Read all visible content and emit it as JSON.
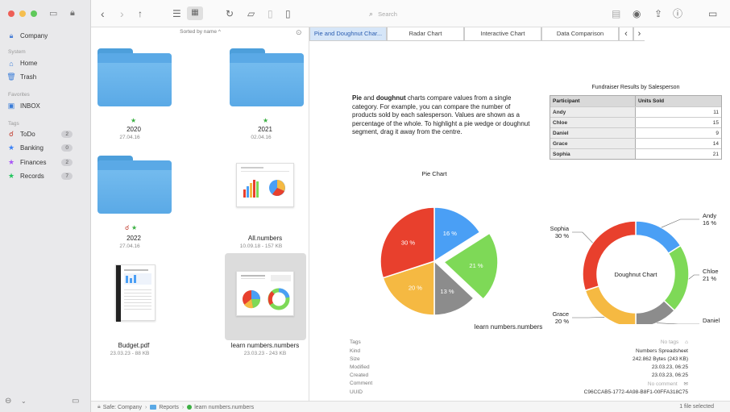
{
  "sidebar": {
    "account": "Company",
    "section_system": "System",
    "section_favorites": "Favorites",
    "section_tags": "Tags",
    "items": [
      {
        "label": "Home",
        "icon": "home-icon"
      },
      {
        "label": "Trash",
        "icon": "trash-icon"
      },
      {
        "label": "INBOX",
        "icon": "inbox-icon"
      }
    ],
    "tags": [
      {
        "label": "ToDo",
        "count": "2",
        "color": "#c0392b"
      },
      {
        "label": "Banking",
        "count": "0",
        "color": "#3b82f6"
      },
      {
        "label": "Finances",
        "count": "2",
        "color": "#a855f7"
      },
      {
        "label": "Records",
        "count": "7",
        "color": "#22c55e"
      }
    ]
  },
  "toolbar": {
    "search_placeholder": "Search"
  },
  "filelist": {
    "sort_label": "Sorted by name ^",
    "files": [
      {
        "name": "2020",
        "date": "27.04.16"
      },
      {
        "name": "2021",
        "date": "02.04.16"
      },
      {
        "name": "2022",
        "date": "27.04.16"
      },
      {
        "name": "All.numbers",
        "date": "10.09.18 - 157 KB"
      },
      {
        "name": "Budget.pdf",
        "date": "23.03.23 - 88 KB"
      },
      {
        "name": "learn numbers.numbers",
        "date": "23.03.23 - 243 KB"
      }
    ]
  },
  "preview": {
    "tabs": [
      "Pie and Doughnut Char...",
      "Radar Chart",
      "Interactive Chart",
      "Data Comparison"
    ],
    "intro_bold1": "Pie",
    "intro_mid1": " and ",
    "intro_bold2": "doughnut",
    "intro_rest": " charts compare values from a single category. For example, you can compare the number of products sold by each salesperson. Values are shown as a percentage of the whole. To highlight a pie wedge or doughnut segment, drag it away from the centre.",
    "table_title": "Fundraiser Results by Salesperson",
    "table_headers": [
      "Participant",
      "Units Sold"
    ],
    "table_rows": [
      [
        "Andy",
        "11"
      ],
      [
        "Chloe",
        "15"
      ],
      [
        "Daniel",
        "9"
      ],
      [
        "Grace",
        "14"
      ],
      [
        "Sophia",
        "21"
      ]
    ],
    "file_title": "learn numbers.numbers",
    "meta": [
      {
        "label": "Tags",
        "value": "No tags"
      },
      {
        "label": "Kind",
        "value": "Numbers Spreadsheet"
      },
      {
        "label": "Size",
        "value": "242.862 Bytes (243 KB)"
      },
      {
        "label": "Modified",
        "value": "23.03.23, 06:25"
      },
      {
        "label": "Created",
        "value": "23.03.23, 06:25"
      },
      {
        "label": "Comment",
        "value": "No comment"
      },
      {
        "label": "UUID",
        "value": "C96CCAB5-1772-4A98-B8F1-00FFA318C75"
      }
    ]
  },
  "chart_data": [
    {
      "type": "pie",
      "title": "Pie Chart",
      "categories": [
        "Andy",
        "Chloe",
        "Daniel",
        "Grace",
        "Sophia"
      ],
      "values": [
        16,
        21,
        13,
        20,
        30
      ],
      "value_labels": [
        "16 %",
        "21 %",
        "13 %",
        "20 %",
        "30 %"
      ],
      "colors": [
        "#4a9ff5",
        "#7ed957",
        "#8c8c8c",
        "#f5b942",
        "#e8402d"
      ],
      "legend": "bottom"
    },
    {
      "type": "pie",
      "title": "Doughnut Chart",
      "categories": [
        "Andy",
        "Chloe",
        "Daniel",
        "Grace",
        "Sophia"
      ],
      "values": [
        16,
        21,
        13,
        20,
        30
      ],
      "value_labels": [
        "16 %",
        "21 %",
        "13 %",
        "20 %",
        "30 %"
      ],
      "colors": [
        "#4a9ff5",
        "#7ed957",
        "#8c8c8c",
        "#f5b942",
        "#e8402d"
      ]
    }
  ],
  "statusbar": {
    "path": [
      "Safe: Company",
      "Reports",
      "learn numbers.numbers"
    ],
    "selection": "1 file selected"
  }
}
